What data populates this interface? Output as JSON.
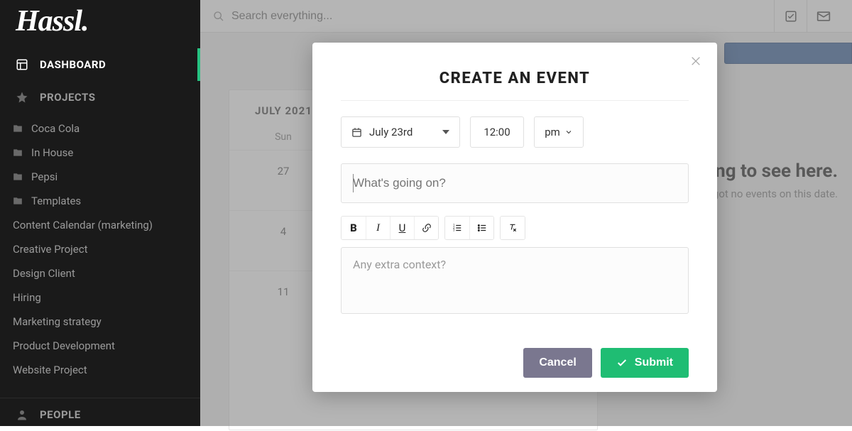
{
  "brand": "Hassl.",
  "sidebar": {
    "dashboard": "DASHBOARD",
    "projects": "PROJECTS",
    "people": "PEOPLE",
    "items": [
      {
        "label": "Coca Cola",
        "folder": true
      },
      {
        "label": "In House",
        "folder": true
      },
      {
        "label": "Pepsi",
        "folder": true
      },
      {
        "label": "Templates",
        "folder": true
      },
      {
        "label": "Content Calendar (marketing)",
        "folder": false
      },
      {
        "label": "Creative Project",
        "folder": false
      },
      {
        "label": "Design Client",
        "folder": false
      },
      {
        "label": "Hiring",
        "folder": false
      },
      {
        "label": "Marketing strategy",
        "folder": false
      },
      {
        "label": "Product Development",
        "folder": false
      },
      {
        "label": "Website Project",
        "folder": false
      }
    ]
  },
  "search": {
    "placeholder": "Search everything..."
  },
  "calendar": {
    "month_label": "JULY 2021",
    "day_headers": [
      "Sun"
    ],
    "rows": [
      [
        "27"
      ],
      [
        "4"
      ],
      [
        "11"
      ]
    ]
  },
  "empty_state": {
    "heading_visible": "thing to see here.",
    "sub_visible": "e got no events on this date."
  },
  "modal": {
    "title": "CREATE AN EVENT",
    "date": "July 23rd",
    "time": "12:00",
    "ampm": "pm",
    "title_placeholder": "What's going on?",
    "desc_placeholder": "Any extra context?",
    "toolbar": {
      "bold": "B",
      "italic": "I",
      "underline": "U"
    },
    "cancel": "Cancel",
    "submit": "Submit"
  }
}
